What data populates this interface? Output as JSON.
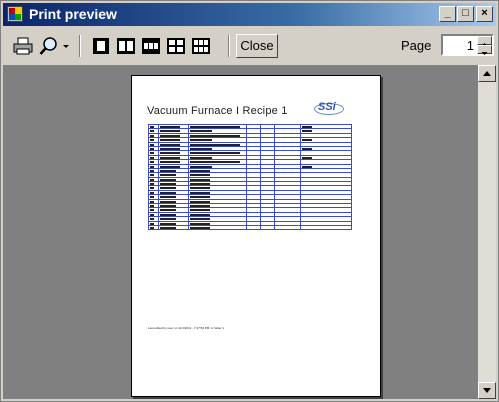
{
  "window": {
    "title": "Print preview"
  },
  "caption_buttons": {
    "minimize": "_",
    "maximize": "□",
    "close": "×"
  },
  "toolbar": {
    "icons": [
      "printer-icon",
      "zoom-icon",
      "zoom-dropdown-icon",
      "one-page-icon",
      "two-pages-icon",
      "three-pages-icon",
      "four-pages-icon",
      "six-pages-icon"
    ],
    "close_label": "Close",
    "page_label": "Page",
    "page_value": "1"
  },
  "document": {
    "title": "Vacuum Furnace I Recipe 1",
    "logo_text": "SSi",
    "footer": "Last edited by user on 11/1/2011 - 7:37:50 PM, in folder 1",
    "table_rows": 24,
    "table_cols": 7
  }
}
